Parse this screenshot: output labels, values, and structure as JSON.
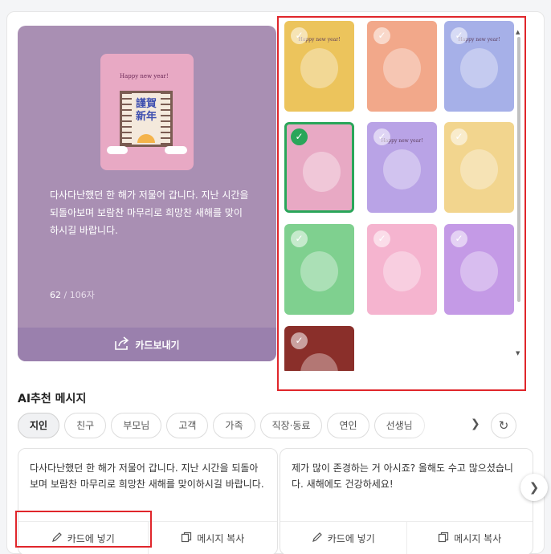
{
  "preview": {
    "card_greeting": "Happy new year!",
    "card_chars": "謹賀新年",
    "message": "다사다난했던 한 해가 저물어 갑니다. 지난 시간을 되돌아보며 보람찬 마무리로 희망찬 새해를 맞이하시길 바랍니다.",
    "count": "62",
    "count_max": " / 106자",
    "send_label": "카드보내기"
  },
  "templates": [
    {
      "bg": "#ecc45c",
      "label": "Happy new year!",
      "icon": "ornament-icon",
      "selected": false
    },
    {
      "bg": "#f2a88a",
      "label": "",
      "icon": "lucky-bag-icon",
      "selected": false
    },
    {
      "bg": "#a6b0e8",
      "label": "Happy new year!",
      "icon": "magpie-icon",
      "selected": false
    },
    {
      "bg": "#e8a9c4",
      "label": "",
      "icon": "door-icon",
      "selected": true
    },
    {
      "bg": "#b9a3e6",
      "label": "Happy new year!",
      "icon": "sunrise-icon",
      "selected": false
    },
    {
      "bg": "#f2d58e",
      "label": "",
      "icon": "shopping-bag-icon",
      "selected": false
    },
    {
      "bg": "#7fd08f",
      "label": "",
      "icon": "number-2023-icon",
      "selected": false
    },
    {
      "bg": "#f5b4cf",
      "label": "",
      "icon": "gift-wrap-icon",
      "selected": false
    },
    {
      "bg": "#c49ae6",
      "label": "",
      "icon": "pouch-icon",
      "selected": false
    },
    {
      "bg": "#8a2f2a",
      "label": "",
      "icon": "character-icon",
      "selected": false
    }
  ],
  "ai": {
    "title": "AI추천 메시지",
    "tabs": [
      "지인",
      "친구",
      "부모님",
      "고객",
      "가족",
      "직장·동료",
      "연인",
      "선생님"
    ],
    "active_tab": 0,
    "messages": [
      {
        "text": "다사다난했던 한 해가 저물어 갑니다. 지난 시간을 되돌아보며 보람찬 마무리로 희망찬 새해를 맞이하시길 바랍니다.",
        "insert_label": "카드에 넣기",
        "copy_label": "메시지 복사"
      },
      {
        "text": "제가 많이 존경하는 거 아시죠? 올해도 수고 많으셨습니다. 새해에도 건강하세요!",
        "insert_label": "카드에 넣기",
        "copy_label": "메시지 복사"
      }
    ]
  },
  "colors": {
    "highlight": "#e0262b",
    "selected": "#2aa65a",
    "preview_bg": "#a98fb3"
  }
}
